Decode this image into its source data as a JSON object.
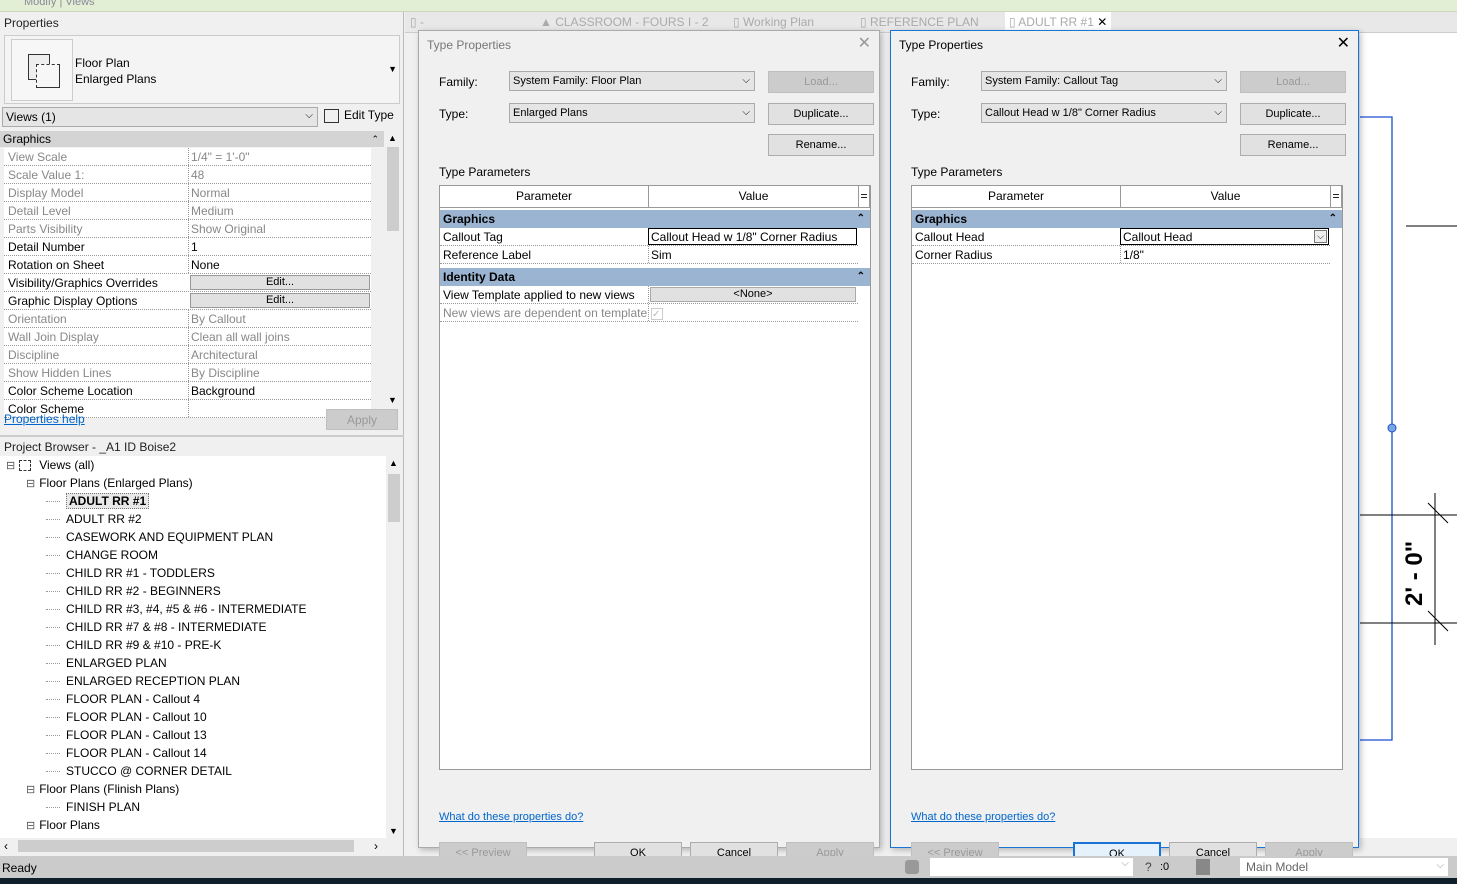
{
  "ribbon": {
    "context_tab": "Modify | Views"
  },
  "properties": {
    "title": "Properties",
    "type_family": "Floor Plan",
    "type_name": "Enlarged Plans",
    "filter": "Views (1)",
    "edit_type": "Edit Type",
    "group": "Graphics",
    "rows": [
      {
        "label": "View Scale",
        "value": "1/4\" = 1'-0\"",
        "disabled": true
      },
      {
        "label": "Scale Value    1:",
        "value": "48",
        "disabled": true
      },
      {
        "label": "Display Model",
        "value": "Normal",
        "disabled": true
      },
      {
        "label": "Detail Level",
        "value": "Medium",
        "disabled": true
      },
      {
        "label": "Parts Visibility",
        "value": "Show Original",
        "disabled": true
      },
      {
        "label": "Detail Number",
        "value": "1",
        "disabled": false
      },
      {
        "label": "Rotation on Sheet",
        "value": "None",
        "disabled": false
      },
      {
        "label": "Visibility/Graphics Overrides",
        "value": "Edit...",
        "button": true
      },
      {
        "label": "Graphic Display Options",
        "value": "Edit...",
        "button": true
      },
      {
        "label": "Orientation",
        "value": "By Callout",
        "disabled": true
      },
      {
        "label": "Wall Join Display",
        "value": "Clean all wall joins",
        "disabled": true
      },
      {
        "label": "Discipline",
        "value": "Architectural",
        "disabled": true
      },
      {
        "label": "Show Hidden Lines",
        "value": "By Discipline",
        "disabled": true
      },
      {
        "label": "Color Scheme Location",
        "value": "Background",
        "disabled": false
      },
      {
        "label": "Color Scheme",
        "value": "",
        "disabled": false
      }
    ],
    "help_link": "Properties help",
    "apply": "Apply"
  },
  "browser": {
    "title": "Project Browser - _A1 ID Boise2",
    "items": [
      {
        "label": "Views (all)",
        "level": 0,
        "expander": "−"
      },
      {
        "label": "Floor Plans (Enlarged Plans)",
        "level": 1,
        "expander": "−"
      },
      {
        "label": "ADULT RR #1",
        "level": 2,
        "selected": true
      },
      {
        "label": "ADULT RR #2",
        "level": 2
      },
      {
        "label": "CASEWORK AND EQUIPMENT PLAN",
        "level": 2
      },
      {
        "label": "CHANGE ROOM",
        "level": 2
      },
      {
        "label": "CHILD RR #1 - TODDLERS",
        "level": 2
      },
      {
        "label": "CHILD RR #2 - BEGINNERS",
        "level": 2
      },
      {
        "label": "CHILD RR #3, #4, #5 & #6 - INTERMEDIATE",
        "level": 2
      },
      {
        "label": "CHILD RR #7 & #8 - INTERMEDIATE",
        "level": 2
      },
      {
        "label": "CHILD RR #9 & #10 - PRE-K",
        "level": 2
      },
      {
        "label": "ENLARGED PLAN",
        "level": 2
      },
      {
        "label": "ENLARGED RECEPTION PLAN",
        "level": 2
      },
      {
        "label": "FLOOR PLAN - Callout 4",
        "level": 2
      },
      {
        "label": "FLOOR PLAN - Callout 10",
        "level": 2
      },
      {
        "label": "FLOOR PLAN - Callout 13",
        "level": 2
      },
      {
        "label": "FLOOR PLAN - Callout 14",
        "level": 2
      },
      {
        "label": "STUCCO @ CORNER DETAIL",
        "level": 2
      },
      {
        "label": "Floor Plans (Flinish Plans)",
        "level": 1,
        "expander": "−"
      },
      {
        "label": "FINISH PLAN",
        "level": 2
      },
      {
        "label": "Floor Plans",
        "level": 1,
        "expander": "−"
      }
    ]
  },
  "tabs": [
    {
      "label": "-",
      "icon": "view-icon"
    },
    {
      "label": "CLASSROOM - FOURS I - 2",
      "icon": "up-arrow-icon"
    },
    {
      "label": "Working Plan",
      "icon": "floor-plan-icon"
    },
    {
      "label": "REFERENCE PLAN",
      "icon": "floor-plan-icon"
    },
    {
      "label": "ADULT RR #1",
      "icon": "floor-plan-icon",
      "active": true
    }
  ],
  "dialog1": {
    "title": "Type Properties",
    "family_label": "Family:",
    "family": "System Family: Floor Plan",
    "type_label": "Type:",
    "type": "Enlarged Plans",
    "load": "Load...",
    "duplicate": "Duplicate...",
    "rename": "Rename...",
    "params_title": "Type Parameters",
    "col_param": "Parameter",
    "col_value": "Value",
    "groups": [
      {
        "name": "Graphics",
        "rows": [
          {
            "label": "Callout Tag",
            "value": "Callout Head w 1/8\" Corner Radius"
          },
          {
            "label": "Reference Label",
            "value": "Sim"
          }
        ]
      },
      {
        "name": "Identity Data",
        "rows": [
          {
            "label": "View Template applied to new views",
            "value": "<None>"
          },
          {
            "label": "New views are dependent on template",
            "value": ""
          }
        ]
      }
    ],
    "help": "What do these properties do?",
    "preview": "<< Preview",
    "ok": "OK",
    "cancel": "Cancel",
    "apply": "Apply"
  },
  "dialog2": {
    "title": "Type Properties",
    "family_label": "Family:",
    "family": "System Family: Callout Tag",
    "type_label": "Type:",
    "type": "Callout Head w 1/8\" Corner Radius",
    "load": "Load...",
    "duplicate": "Duplicate...",
    "rename": "Rename...",
    "params_title": "Type Parameters",
    "col_param": "Parameter",
    "col_value": "Value",
    "groups": [
      {
        "name": "Graphics",
        "rows": [
          {
            "label": "Callout Head",
            "value": "Callout Head"
          },
          {
            "label": "Corner Radius",
            "value": "1/8\""
          }
        ]
      }
    ],
    "help": "What do these properties do?",
    "preview": "<< Preview",
    "ok": "OK",
    "cancel": "Cancel",
    "apply": "Apply"
  },
  "canvas": {
    "dimension": "2' - 0\"",
    "selection_color": "#1a4fd0"
  },
  "status": {
    "text": "Ready",
    "worksets": ":0",
    "model": "Main Model"
  }
}
